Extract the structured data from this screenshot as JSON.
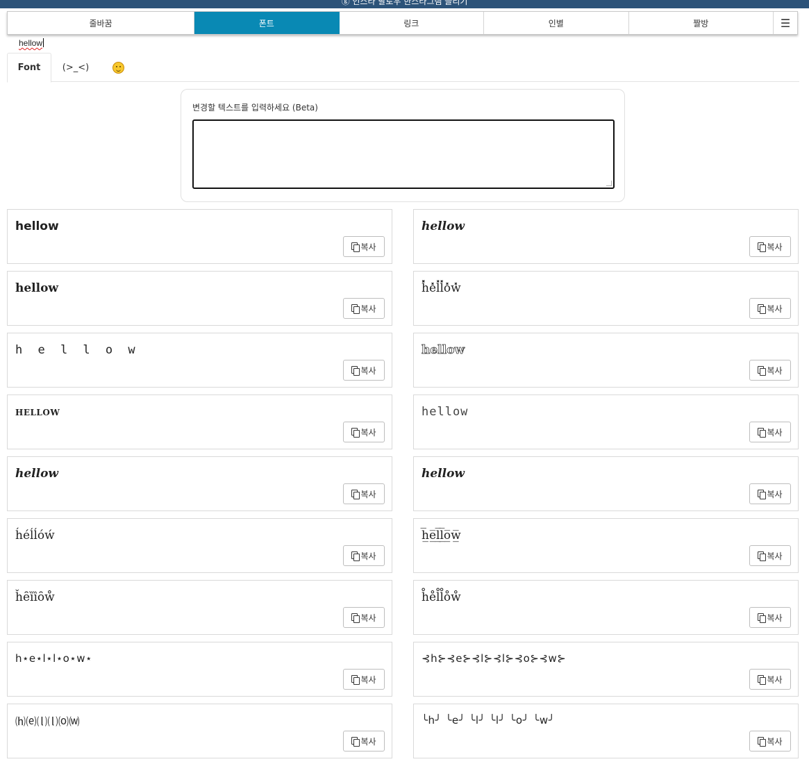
{
  "topbar": {
    "text": "ⓖ 인스타 팔로우 한스타그램 늘리기"
  },
  "nav": {
    "items": [
      "줄바꿈",
      "폰트",
      "링크",
      "인별",
      "짤방"
    ],
    "active_index": 1,
    "menu_icon": "hamburger-menu-icon"
  },
  "tabs": {
    "font": "Font",
    "emoticon": "(>_<)",
    "emoji_icon": "smiley-face-icon"
  },
  "input": {
    "label": "변경할 텍스트를 입력하세요 (Beta)",
    "value": "hellow"
  },
  "copy_label": "복사",
  "results": {
    "left": [
      "hellow",
      "hellow",
      "h e l l o w",
      "HELLOW",
      "hellow",
      "h́éĺĺóẃ",
      "ȟȇȉȉȏẘ",
      "h⋆e⋆l⋆l⋆o⋆w⋆",
      "⒣⒠⒧⒧⒪⒲"
    ],
    "right": [
      "hellow",
      "h̽̽e̽l̽l̽o̽w̽",
      "hellow",
      "hellow",
      "hellow",
      "h̲̅e̲̅l̲̅l̲̅o̲̅w̲̅",
      "h̊e̊l̊l̊o̊ẘ",
      "⊰h⊱⊰e⊱⊰l⊱⊰l⊱⊰o⊱⊰w⊱",
      "╰h╯ ╰e╯ ╰l╯ ╰l╯ ╰o╯ ╰w╯"
    ]
  }
}
